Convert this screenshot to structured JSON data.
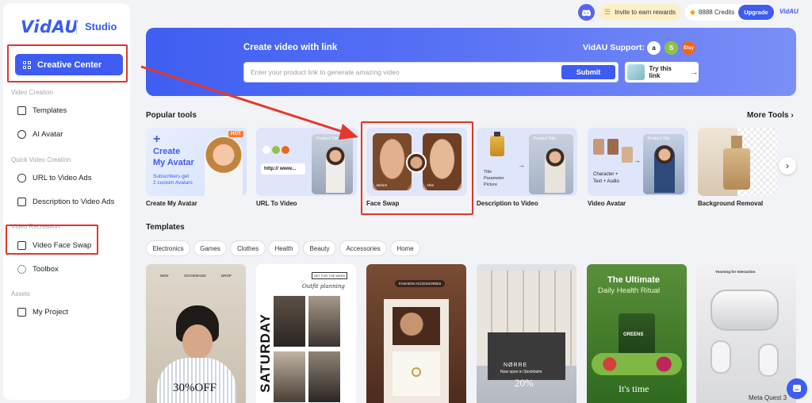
{
  "brand": {
    "logo": "VidAU",
    "studio": "Studio",
    "small_logo": "VidAU"
  },
  "sidebar": {
    "creative_center": "Creative Center",
    "sections": [
      {
        "label": "Video Creation",
        "items": [
          "Templates",
          "AI Avatar"
        ]
      },
      {
        "label": "Quick Video Creation",
        "items": [
          "URL to Video Ads",
          "Description to Video Ads"
        ]
      },
      {
        "label": "Video Recreation",
        "items": [
          "Video Face Swap",
          "Toolbox"
        ]
      },
      {
        "label": "Assets",
        "items": [
          "My Project"
        ]
      }
    ]
  },
  "topbar": {
    "invite": "Invite to earn rewards",
    "credits": "8888 Credits",
    "upgrade": "Upgrade"
  },
  "banner": {
    "title": "Create video with link",
    "support_label": "VidAU Support:",
    "stores": [
      "a",
      "S",
      "Etsy"
    ],
    "input_placeholder": "Enter your product link to generate amazing video",
    "submit": "Submit",
    "try_link": "Try this link"
  },
  "popular": {
    "title": "Popular tools",
    "more": "More Tools",
    "tools": [
      "Create My Avatar",
      "URL To Video",
      "Face Swap",
      "Description to Video",
      "Video Avatar",
      "Background Removal"
    ],
    "avatar_card": {
      "headline_1": "Create",
      "headline_2": "My Avatar",
      "sub_1": "Subscribers get",
      "sub_2": "2 custom Avatars",
      "badge": "HOT"
    },
    "url_card": {
      "url_text": "http:// www...",
      "product_title": "Product Title"
    },
    "face_card": {
      "before": "Before",
      "after": "After"
    },
    "desc_card": {
      "line1": "Title",
      "line2": "Parameter",
      "line3": "Picture",
      "product_title": "Product Title"
    },
    "avatar_video_card": {
      "line1": "Character +",
      "line2": "Text + Audio",
      "product_title": "Product Title"
    }
  },
  "templates": {
    "title": "Templates",
    "chips": [
      "Electronics",
      "Games",
      "Clothes",
      "Health",
      "Beauty",
      "Accessories",
      "Home"
    ],
    "tiles": {
      "t1": {
        "nav": [
          "NEW",
          "ON-DEMAND",
          "DROP"
        ],
        "promo": "30%OFF"
      },
      "t2": {
        "tag": "SET FOR THE WEEK",
        "script": "Outfit planning",
        "word": "SATURDAY"
      },
      "t3": {
        "tag": "FASHION ACCESSORIES"
      },
      "t4": {
        "brand": "NØRRE",
        "line": "Now open in Stockholm",
        "promo": "20%"
      },
      "t5": {
        "title_1": "The Ultimate",
        "title_2": "Daily Health Ritual",
        "product": "GREENS",
        "bottom": "It's time"
      },
      "t6": {
        "top": "Yearning for Interaction",
        "bottom": "Meta Quest 3"
      }
    }
  }
}
